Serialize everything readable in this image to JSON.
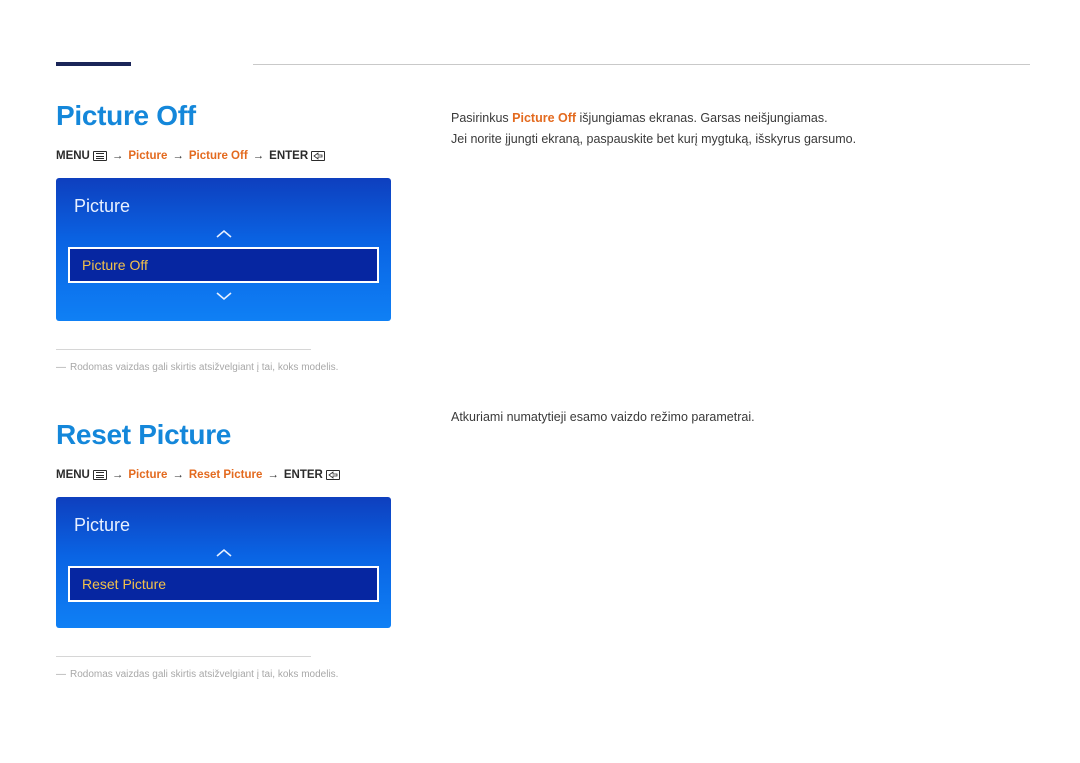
{
  "section1": {
    "title": "Picture Off",
    "breadcrumb": {
      "menu_label": "MENU",
      "path1": "Picture",
      "path2": "Picture Off",
      "enter_label": "ENTER"
    },
    "osd": {
      "panel_title": "Picture",
      "selected_item": "Picture Off"
    },
    "footnote": "Rodomas vaizdas gali skirtis atsižvelgiant į tai, koks modelis.",
    "body_line1_prefix": "Pasirinkus ",
    "body_line1_highlight": "Picture Off",
    "body_line1_suffix": " išjungiamas ekranas. Garsas neišjungiamas.",
    "body_line2": "Jei norite įjungti ekraną, paspauskite bet kurį mygtuką, išskyrus garsumo."
  },
  "section2": {
    "title": "Reset Picture",
    "breadcrumb": {
      "menu_label": "MENU",
      "path1": "Picture",
      "path2": "Reset Picture",
      "enter_label": "ENTER"
    },
    "osd": {
      "panel_title": "Picture",
      "selected_item": "Reset Picture"
    },
    "footnote": "Rodomas vaizdas gali skirtis atsižvelgiant į tai, koks modelis.",
    "body": "Atkuriami numatytieji esamo vaizdo režimo parametrai."
  },
  "glyphs": {
    "arrow": "→",
    "dash": "―"
  }
}
